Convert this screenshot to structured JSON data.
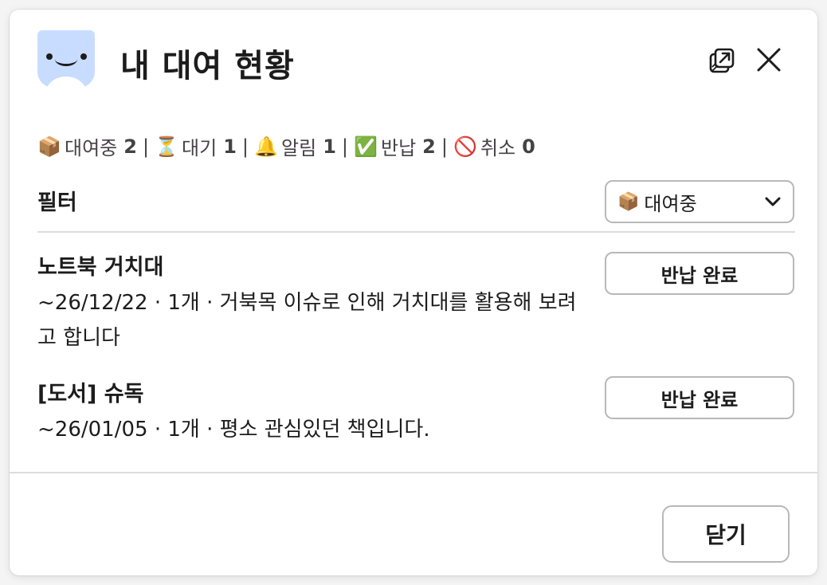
{
  "header": {
    "title": "내 대여 현황"
  },
  "summary": {
    "items": [
      {
        "icon": "package-icon",
        "emoji": "📦",
        "label": "대여중",
        "count": "2"
      },
      {
        "icon": "hourglass-icon",
        "emoji": "⏳",
        "label": "대기",
        "count": "1"
      },
      {
        "icon": "bell-icon",
        "emoji": "🔔",
        "label": "알림",
        "count": "1"
      },
      {
        "icon": "check-mark-icon",
        "emoji": "✅",
        "label": "반납",
        "count": "2"
      },
      {
        "icon": "prohibited-icon",
        "emoji": "🚫",
        "label": "취소",
        "count": "0"
      }
    ],
    "separator": "|"
  },
  "filter": {
    "label": "필터",
    "selected_emoji": "📦",
    "selected": "대여중"
  },
  "items": [
    {
      "name": "노트북 거치대",
      "desc": "~26/12/22 · 1개 · 거북목 이슈로 인해 거치대를 활용해 보려고 합니다",
      "button": "반납 완료"
    },
    {
      "name": "[도서] 슈독",
      "desc": "~26/01/05 · 1개 · 평소 관심있던 책입니다.",
      "button": "반납 완료"
    }
  ],
  "footer": {
    "close_label": "닫기"
  },
  "colors": {
    "icon_background": "#c8dcff",
    "border": "#b8b8b8",
    "text": "#1d1c1d"
  }
}
